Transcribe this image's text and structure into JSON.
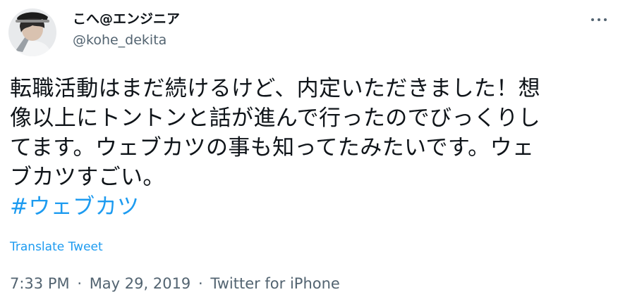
{
  "author": {
    "display_name": "こへ@エンジニア",
    "handle": "@kohe_dekita"
  },
  "tweet": {
    "lines": [
      "転職活動はまだ続けるけど、内定いただきました！想",
      "像以上にトントンと話が進んで行ったのでびっくりし",
      "てます。ウェブカツの事も知ってたみたいです。ウェ",
      "ブカツすごい。"
    ],
    "hashtag": "#ウェブカツ"
  },
  "translate_label": "Translate Tweet",
  "meta": {
    "time": "7:33 PM",
    "separator": "·",
    "date": "May 29, 2019",
    "source": "Twitter for iPhone"
  },
  "icons": {
    "more": "more-horizontal-icon"
  },
  "colors": {
    "link": "#1d9bf0",
    "text": "#0f1419",
    "secondary": "#536471"
  }
}
